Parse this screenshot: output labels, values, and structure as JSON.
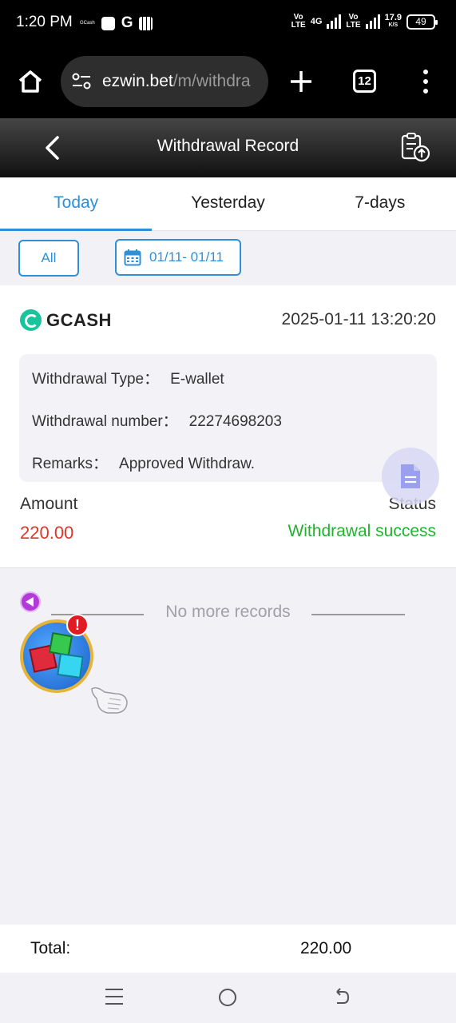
{
  "status_bar": {
    "time": "1:20 PM",
    "mini_label": "GCash",
    "g_label": "G",
    "volte1": "Vo",
    "lte1": "LTE",
    "net_type": "4G",
    "volte2": "Vo",
    "lte2": "LTE",
    "speed": "17.9",
    "speed_unit": "K/S",
    "battery": "49"
  },
  "browser": {
    "url_host": "ezwin.bet",
    "url_path": "/m/withdra",
    "tab_count": "12"
  },
  "header": {
    "title": "Withdrawal Record"
  },
  "tabs": [
    {
      "label": "Today",
      "active": true
    },
    {
      "label": "Yesterday",
      "active": false
    },
    {
      "label": "7-days",
      "active": false
    }
  ],
  "filters": {
    "all_label": "All",
    "date_range": "01/11- 01/11"
  },
  "record": {
    "brand": "GCASH",
    "datetime": "2025-01-11 13:20:20",
    "type_label": "Withdrawal Type：",
    "type_value": "E-wallet",
    "number_label": "Withdrawal number：",
    "number_value": "22274698203",
    "remarks_label": "Remarks：",
    "remarks_value": "Approved Withdraw.",
    "amount_label": "Amount",
    "amount_value": "220.00",
    "status_label": "Status",
    "status_value": "Withdrawal success"
  },
  "list_end": {
    "text": "No more records"
  },
  "floating": {
    "alert_badge": "!"
  },
  "footer": {
    "total_label": "Total:",
    "total_value": "220.00"
  },
  "colors": {
    "accent": "#2f8fd8",
    "amount": "#e0352b",
    "success": "#1fb42c"
  }
}
